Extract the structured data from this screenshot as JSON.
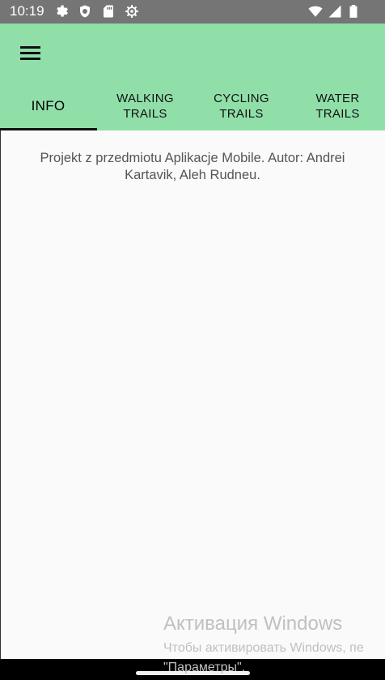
{
  "status_bar": {
    "time": "10:19",
    "left_icons": [
      "gear-icon",
      "shield-icon",
      "sd-card-icon",
      "settings-cog-icon"
    ],
    "right_icons": [
      "wifi-icon",
      "signal-icon",
      "battery-icon"
    ]
  },
  "app_bar": {
    "background": "#90dfa9",
    "menu_icon": "hamburger-menu-icon",
    "tabs": [
      {
        "label": "INFO",
        "active": true
      },
      {
        "label": "WALKING\nTRAILS",
        "active": false
      },
      {
        "label": "CYCLING\nTRAILS",
        "active": false
      },
      {
        "label": "WATER\nTRAILS",
        "active": false
      }
    ]
  },
  "content": {
    "info_text": "Projekt z przedmiotu Aplikacje Mobile. Autor: Andrei Kartavik, Aleh Rudneu."
  },
  "watermark": {
    "title": "Активация Windows",
    "line1": "Чтобы активировать Windows, пе",
    "line2": "\"Параметры\"."
  }
}
